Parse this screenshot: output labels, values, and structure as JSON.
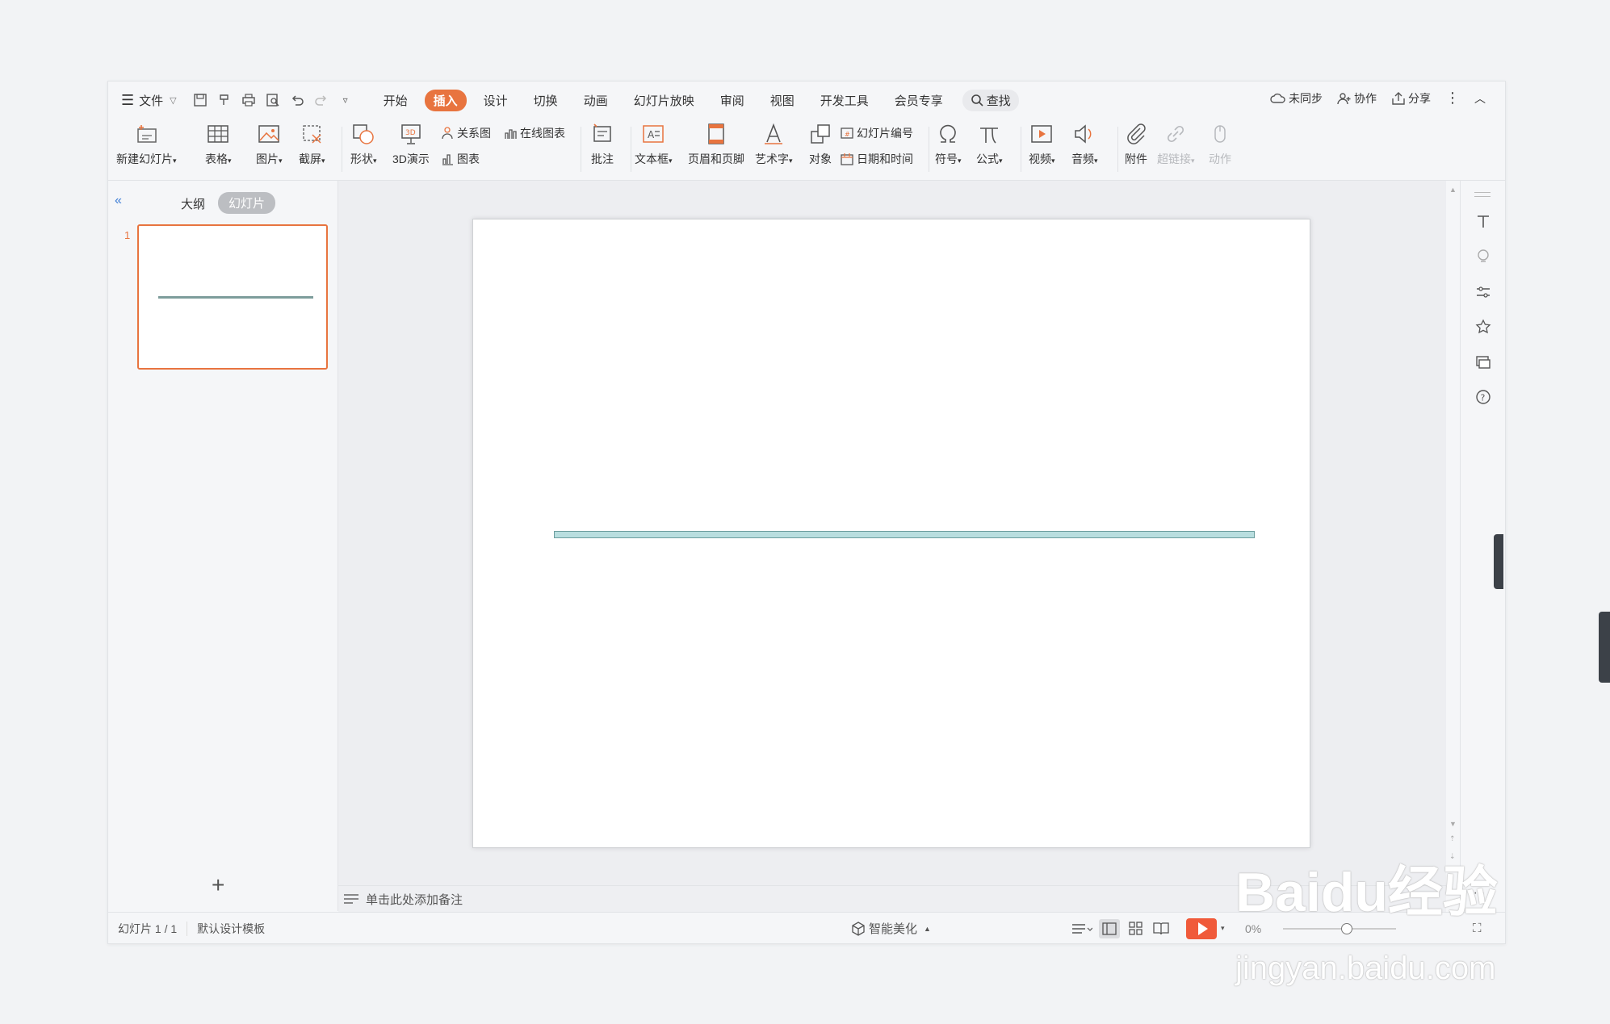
{
  "menubar": {
    "file_label": "文件",
    "tabs": [
      "开始",
      "插入",
      "设计",
      "切换",
      "动画",
      "幻灯片放映",
      "审阅",
      "视图",
      "开发工具",
      "会员专享"
    ],
    "active_tab": "插入",
    "search_label": "查找",
    "sync_label": "未同步",
    "collab_label": "协作",
    "share_label": "分享"
  },
  "ribbon": {
    "new_slide": "新建幻灯片",
    "table": "表格",
    "picture": "图片",
    "screenshot": "截屏",
    "shape": "形状",
    "demo3d": "3D演示",
    "relation": "关系图",
    "online_chart": "在线图表",
    "chart": "图表",
    "comment": "批注",
    "textbox": "文本框",
    "header_footer": "页眉和页脚",
    "wordart": "艺术字",
    "object": "对象",
    "slide_number": "幻灯片编号",
    "date_time": "日期和时间",
    "symbol": "符号",
    "formula": "公式",
    "video": "视频",
    "audio": "音频",
    "attachment": "附件",
    "hyperlink": "超链接",
    "action": "动作"
  },
  "left_panel": {
    "outline_tab": "大纲",
    "slides_tab": "幻灯片",
    "slide_number": "1",
    "add_symbol": "+"
  },
  "notes": {
    "placeholder": "单击此处添加备注"
  },
  "status": {
    "slide_info": "幻灯片 1 / 1",
    "template": "默认设计模板",
    "beautify": "智能美化",
    "zoom": "0%"
  },
  "watermark": {
    "brand": "Baidu经验",
    "url": "jingyan.baidu.com"
  },
  "colors": {
    "accent": "#e8743f",
    "line_fill": "#b9dedf",
    "line_border": "#6c9e9f",
    "play": "#f05a3a"
  }
}
